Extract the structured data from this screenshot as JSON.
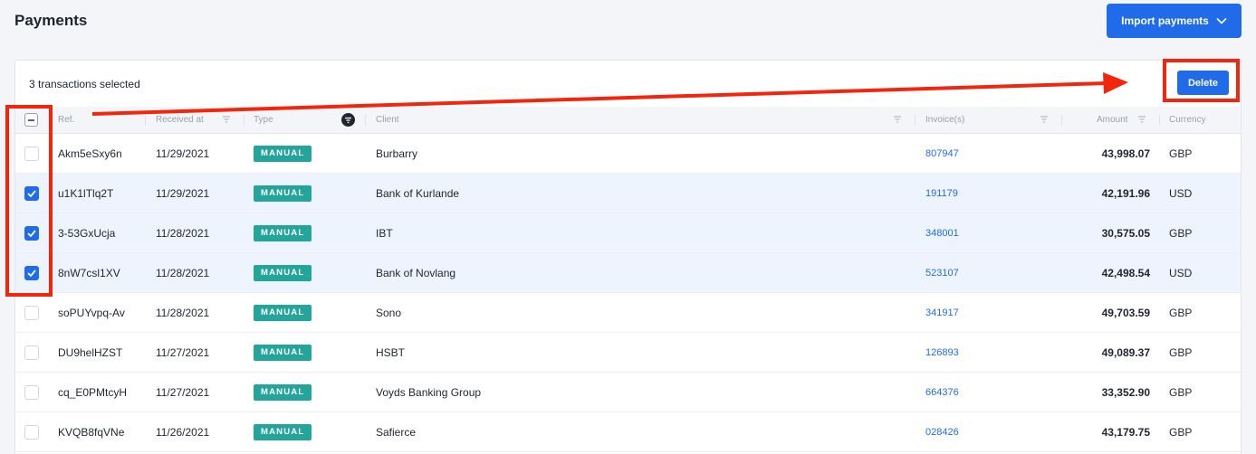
{
  "page": {
    "title": "Payments"
  },
  "header": {
    "import_label": "Import payments"
  },
  "toolbar": {
    "selected_text": "3 transactions selected",
    "delete_label": "Delete"
  },
  "table": {
    "columns": {
      "ref": "Ref.",
      "received_at": "Received at",
      "type": "Type",
      "client": "Client",
      "invoices": "Invoice(s)",
      "amount": "Amount",
      "currency": "Currency"
    },
    "rows": [
      {
        "ref": "Akm5eSxy6n",
        "received_at": "11/29/2021",
        "type": "MANUAL",
        "client": "Burbarry",
        "invoice": "807947",
        "amount": "43,998.07",
        "currency": "GBP",
        "checked": false
      },
      {
        "ref": "u1K1lTlq2T",
        "received_at": "11/29/2021",
        "type": "MANUAL",
        "client": "Bank of Kurlande",
        "invoice": "191179",
        "amount": "42,191.96",
        "currency": "USD",
        "checked": true
      },
      {
        "ref": "3-53GxUcja",
        "received_at": "11/28/2021",
        "type": "MANUAL",
        "client": "IBT",
        "invoice": "348001",
        "amount": "30,575.05",
        "currency": "GBP",
        "checked": true
      },
      {
        "ref": "8nW7csl1XV",
        "received_at": "11/28/2021",
        "type": "MANUAL",
        "client": "Bank of Novlang",
        "invoice": "523107",
        "amount": "42,498.54",
        "currency": "USD",
        "checked": true
      },
      {
        "ref": "soPUYvpq-Av",
        "received_at": "11/28/2021",
        "type": "MANUAL",
        "client": "Sono",
        "invoice": "341917",
        "amount": "49,703.59",
        "currency": "GBP",
        "checked": false
      },
      {
        "ref": "DU9helHZST",
        "received_at": "11/27/2021",
        "type": "MANUAL",
        "client": "HSBT",
        "invoice": "126893",
        "amount": "49,089.37",
        "currency": "GBP",
        "checked": false
      },
      {
        "ref": "cq_E0PMtcyH",
        "received_at": "11/27/2021",
        "type": "MANUAL",
        "client": "Voyds Banking Group",
        "invoice": "664376",
        "amount": "33,352.90",
        "currency": "GBP",
        "checked": false
      },
      {
        "ref": "KVQB8fqVNe",
        "received_at": "11/26/2021",
        "type": "MANUAL",
        "client": "Safierce",
        "invoice": "028426",
        "amount": "43,179.75",
        "currency": "GBP",
        "checked": false
      }
    ]
  },
  "colors": {
    "accent": "#1f6bea",
    "badge": "#24a59c",
    "annotation": "#f2260d"
  }
}
